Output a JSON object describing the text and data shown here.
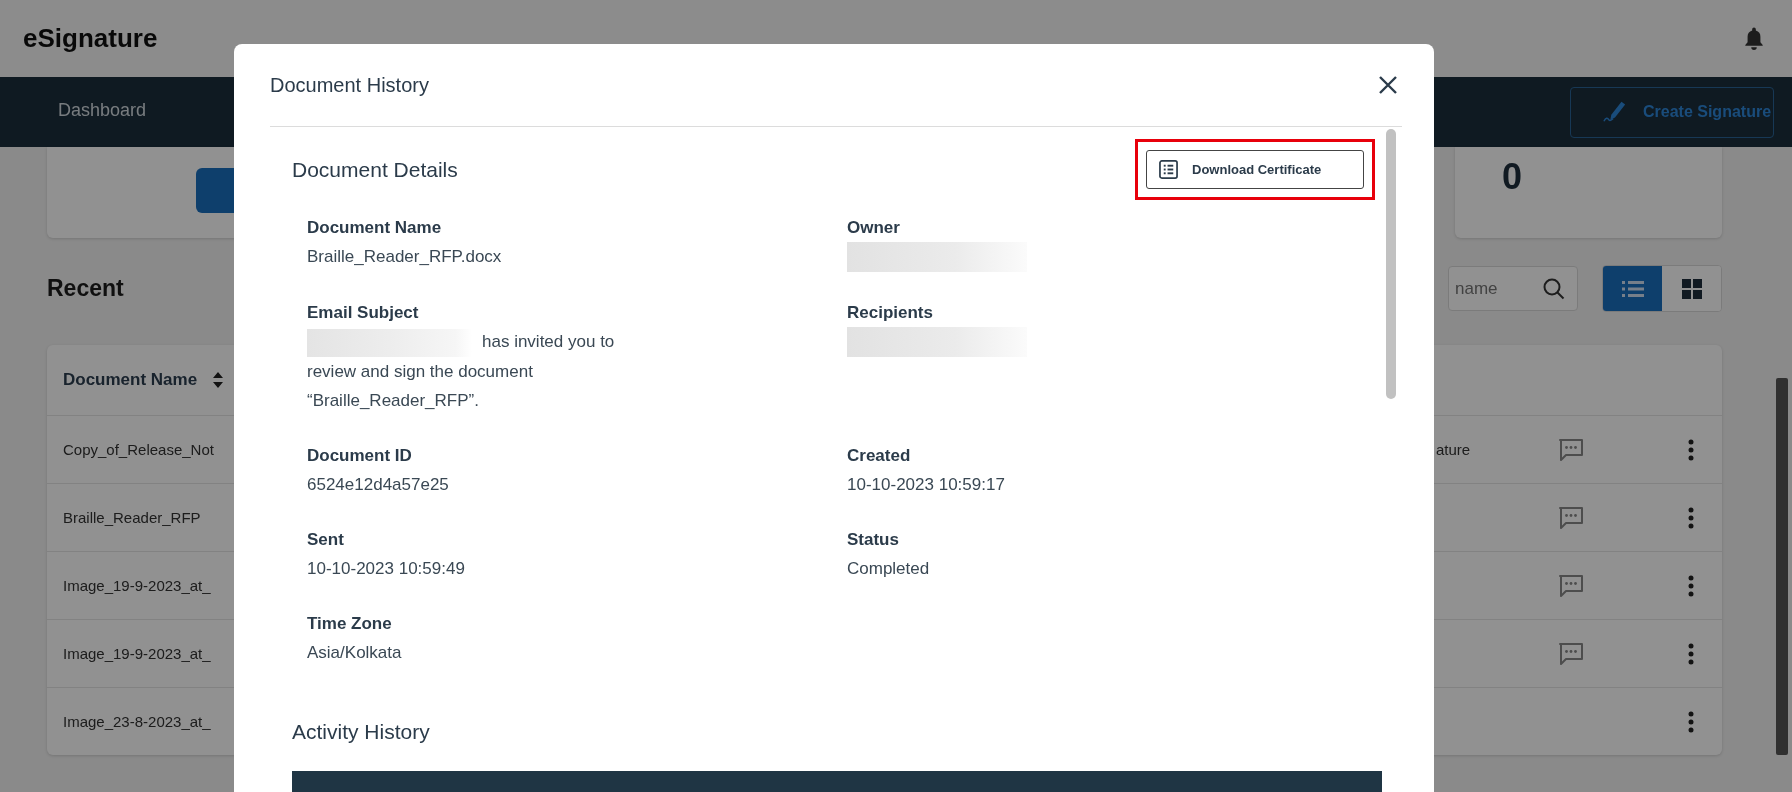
{
  "app": {
    "title": "eSignature"
  },
  "nav": {
    "items": [
      {
        "label": "Dashboard",
        "selected": false
      }
    ],
    "create_button": "Create Signature"
  },
  "summary_card": {
    "value": "0"
  },
  "recent": {
    "title": "Recent",
    "search": {
      "placeholder": "name"
    },
    "views": [
      {
        "kind": "list",
        "selected": true
      },
      {
        "kind": "grid",
        "selected": false
      }
    ],
    "table": {
      "columns": [
        "Document Name"
      ],
      "rows": [
        {
          "name": "Copy_of_Release_Not",
          "column_2": "ature",
          "comments": true
        },
        {
          "name": "Braille_Reader_RFP",
          "comments": true
        },
        {
          "name": "Image_19-9-2023_at_",
          "comments": true
        },
        {
          "name": "Image_19-9-2023_at_",
          "comments": true
        },
        {
          "name": "Image_23-8-2023_at_",
          "comments": false
        }
      ]
    }
  },
  "modal": {
    "title": "Document History",
    "details_title": "Document Details",
    "download_button": "Download Certificate",
    "highlighted": true,
    "fields": [
      {
        "label": "Document Name",
        "kind": "text",
        "value": "Braille_Reader_RFP.docx"
      },
      {
        "label": "Owner",
        "kind": "redacted"
      },
      {
        "label": "Email Subject",
        "kind": "partly_redacted",
        "value": "has invited you to review and sign the document “Braille_Reader_RFP”."
      },
      {
        "label": "Recipients",
        "kind": "redacted"
      },
      {
        "label": "Document ID",
        "kind": "text",
        "value": "6524e12d4a57e25"
      },
      {
        "label": "Created",
        "kind": "text",
        "value": "10-10-2023 10:59:17"
      },
      {
        "label": "Sent",
        "kind": "text",
        "value": "10-10-2023 10:59:49"
      },
      {
        "label": "Status",
        "kind": "text",
        "value": "Completed"
      },
      {
        "label": "Time Zone",
        "kind": "text",
        "value": "Asia/Kolkata"
      }
    ],
    "activity_title": "Activity History"
  }
}
